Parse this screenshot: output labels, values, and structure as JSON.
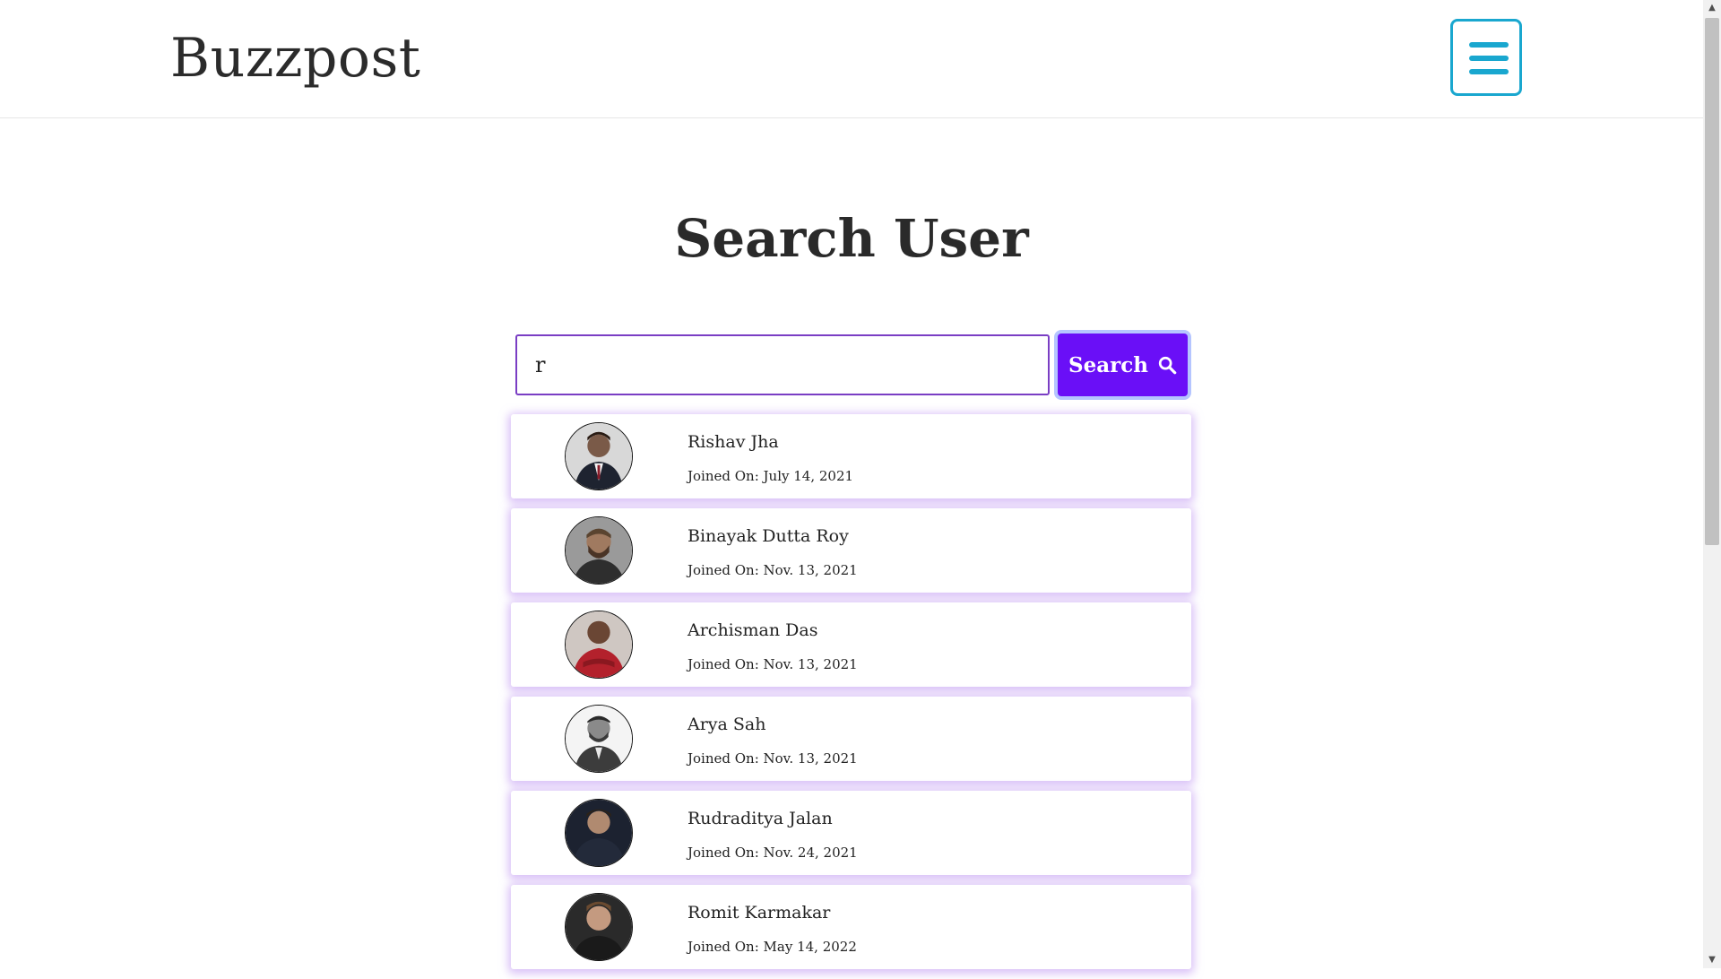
{
  "header": {
    "brand": "Buzzpost",
    "menu_icon": "hamburger-menu-icon",
    "accent": "#19a7cf"
  },
  "page": {
    "title": "Search User"
  },
  "search": {
    "value": "r",
    "button_label": "Search",
    "button_color": "#6a0ff7",
    "icon": "search-icon"
  },
  "users": [
    {
      "name": "Rishav Jha",
      "joined": "Joined On: July 14, 2021"
    },
    {
      "name": "Binayak Dutta Roy",
      "joined": "Joined On: Nov. 13, 2021"
    },
    {
      "name": "Archisman Das",
      "joined": "Joined On: Nov. 13, 2021"
    },
    {
      "name": "Arya Sah",
      "joined": "Joined On: Nov. 13, 2021"
    },
    {
      "name": "Rudraditya Jalan",
      "joined": "Joined On: Nov. 24, 2021"
    },
    {
      "name": "Romit Karmakar",
      "joined": "Joined On: May 14, 2022"
    }
  ]
}
